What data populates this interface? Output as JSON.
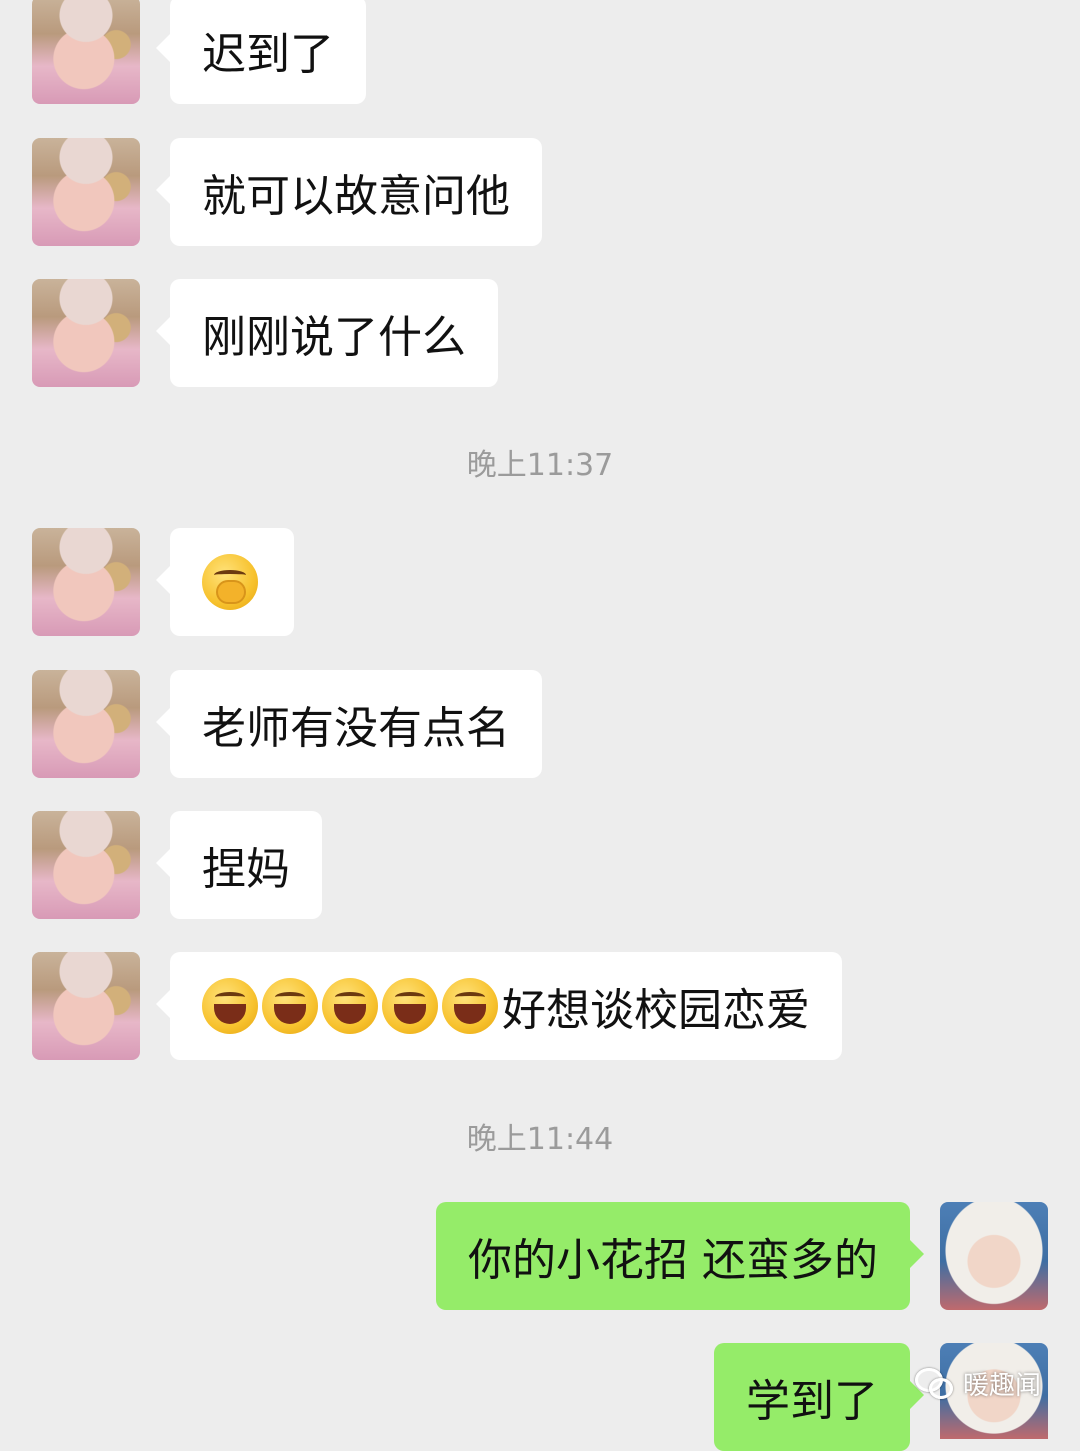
{
  "chat": {
    "messages": [
      {
        "side": "left",
        "text": "迟到了"
      },
      {
        "side": "left",
        "text": "就可以故意问他"
      },
      {
        "side": "left",
        "text": "刚刚说了什么"
      },
      {
        "side": "left",
        "emoji": "covering-mouth-emoji"
      },
      {
        "side": "left",
        "text": "老师有没有点名"
      },
      {
        "side": "left",
        "text": "捏妈"
      },
      {
        "side": "left",
        "emoji_count": 5,
        "emoji": "laughing-emoji",
        "text": "好想谈校园恋爱"
      },
      {
        "side": "right",
        "text": "你的小花招 还蛮多的"
      },
      {
        "side": "right",
        "text": "学到了"
      }
    ],
    "timestamps": [
      "晚上11:37",
      "晚上11:44"
    ]
  },
  "colors": {
    "background": "#ededed",
    "incoming_bubble": "#ffffff",
    "outgoing_bubble": "#95ec69",
    "timestamp": "#9b9b9b"
  },
  "watermark": {
    "text": "暖趣闻",
    "icon": "wechat-logo-icon"
  }
}
